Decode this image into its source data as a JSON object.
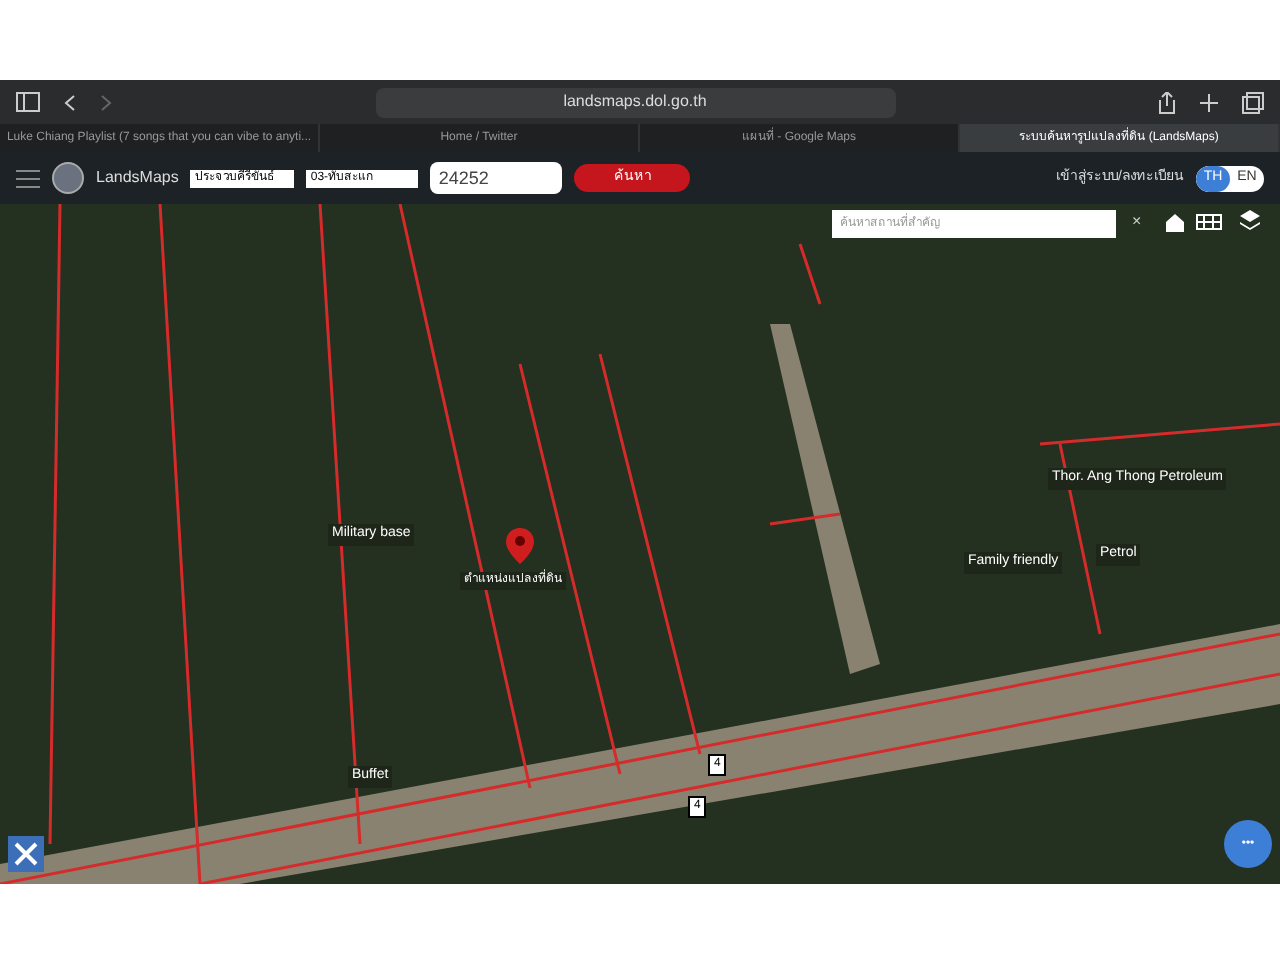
{
  "browser": {
    "url": "landsmaps.dol.go.th"
  },
  "tabs": [
    {
      "label": "Luke Chiang Playlist (7 songs that you can vibe to anyti...",
      "selected": false
    },
    {
      "label": "Home / Twitter",
      "selected": false
    },
    {
      "label": "แผนที่ - Google Maps",
      "selected": false
    },
    {
      "label": "ระบบค้นหารูปแปลงที่ดิน (LandsMaps)",
      "selected": true
    }
  ],
  "header": {
    "app_name": "LandsMaps",
    "province": "ประจวบคีรีขันธ์",
    "district": "03-ทับสะแก",
    "parcel_number": "24252",
    "search_button": "ค้นหา",
    "login": "เข้าสู่ระบบ/ลงทะเบียน",
    "languages": [
      {
        "label": "TH",
        "selected": true
      },
      {
        "label": "EN",
        "selected": false
      }
    ]
  },
  "place_search": {
    "placeholder": "ค้นหาสถานที่สำคัญ",
    "clear": "×"
  },
  "map": {
    "marker_label": "ตำแหน่งแปลงที่ดิน",
    "places": [
      {
        "kind": "poi",
        "name": "Thor. Ang Thong Petroleum"
      },
      {
        "kind": "poi",
        "name": "Military base"
      },
      {
        "kind": "poi",
        "name": "Family friendly"
      },
      {
        "kind": "poi",
        "name": "Petrol"
      },
      {
        "kind": "poi",
        "name": "Buffet"
      }
    ],
    "road_shields": [
      "4",
      "4"
    ],
    "fab": "•••"
  }
}
